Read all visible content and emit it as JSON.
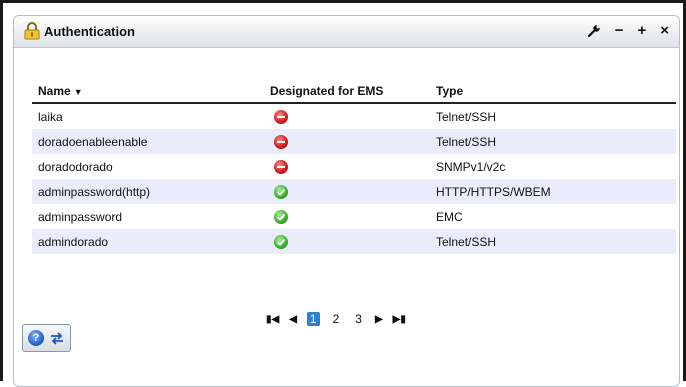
{
  "panel": {
    "title": "Authentication",
    "tools": [
      "−",
      "+",
      "×"
    ]
  },
  "table": {
    "headers": [
      "Name",
      "Designated for EMS",
      "Type"
    ],
    "sort_indicator": "▼",
    "rows": [
      {
        "name": "laika",
        "ems": "no",
        "type": "Telnet/SSH"
      },
      {
        "name": "doradoenableenable",
        "ems": "no",
        "type": "Telnet/SSH"
      },
      {
        "name": "doradodorado",
        "ems": "no",
        "type": "SNMPv1/v2c"
      },
      {
        "name": "adminpassword(http)",
        "ems": "yes",
        "type": "HTTP/HTTPS/WBEM"
      },
      {
        "name": "adminpassword",
        "ems": "yes",
        "type": "EMC"
      },
      {
        "name": "admindorado",
        "ems": "yes",
        "type": "Telnet/SSH"
      }
    ]
  },
  "pager": {
    "first": "▮◀",
    "prev": "◀",
    "pages": [
      "1",
      "2",
      "3"
    ],
    "current": "1",
    "next": "▶",
    "last": "▶▮"
  },
  "bottom": {
    "help_label": "?"
  },
  "colors": {
    "alt_row": "#e9ecfb",
    "current_page": "#2c7fd1",
    "deny": "#d01818",
    "allow": "#3cab2e"
  }
}
